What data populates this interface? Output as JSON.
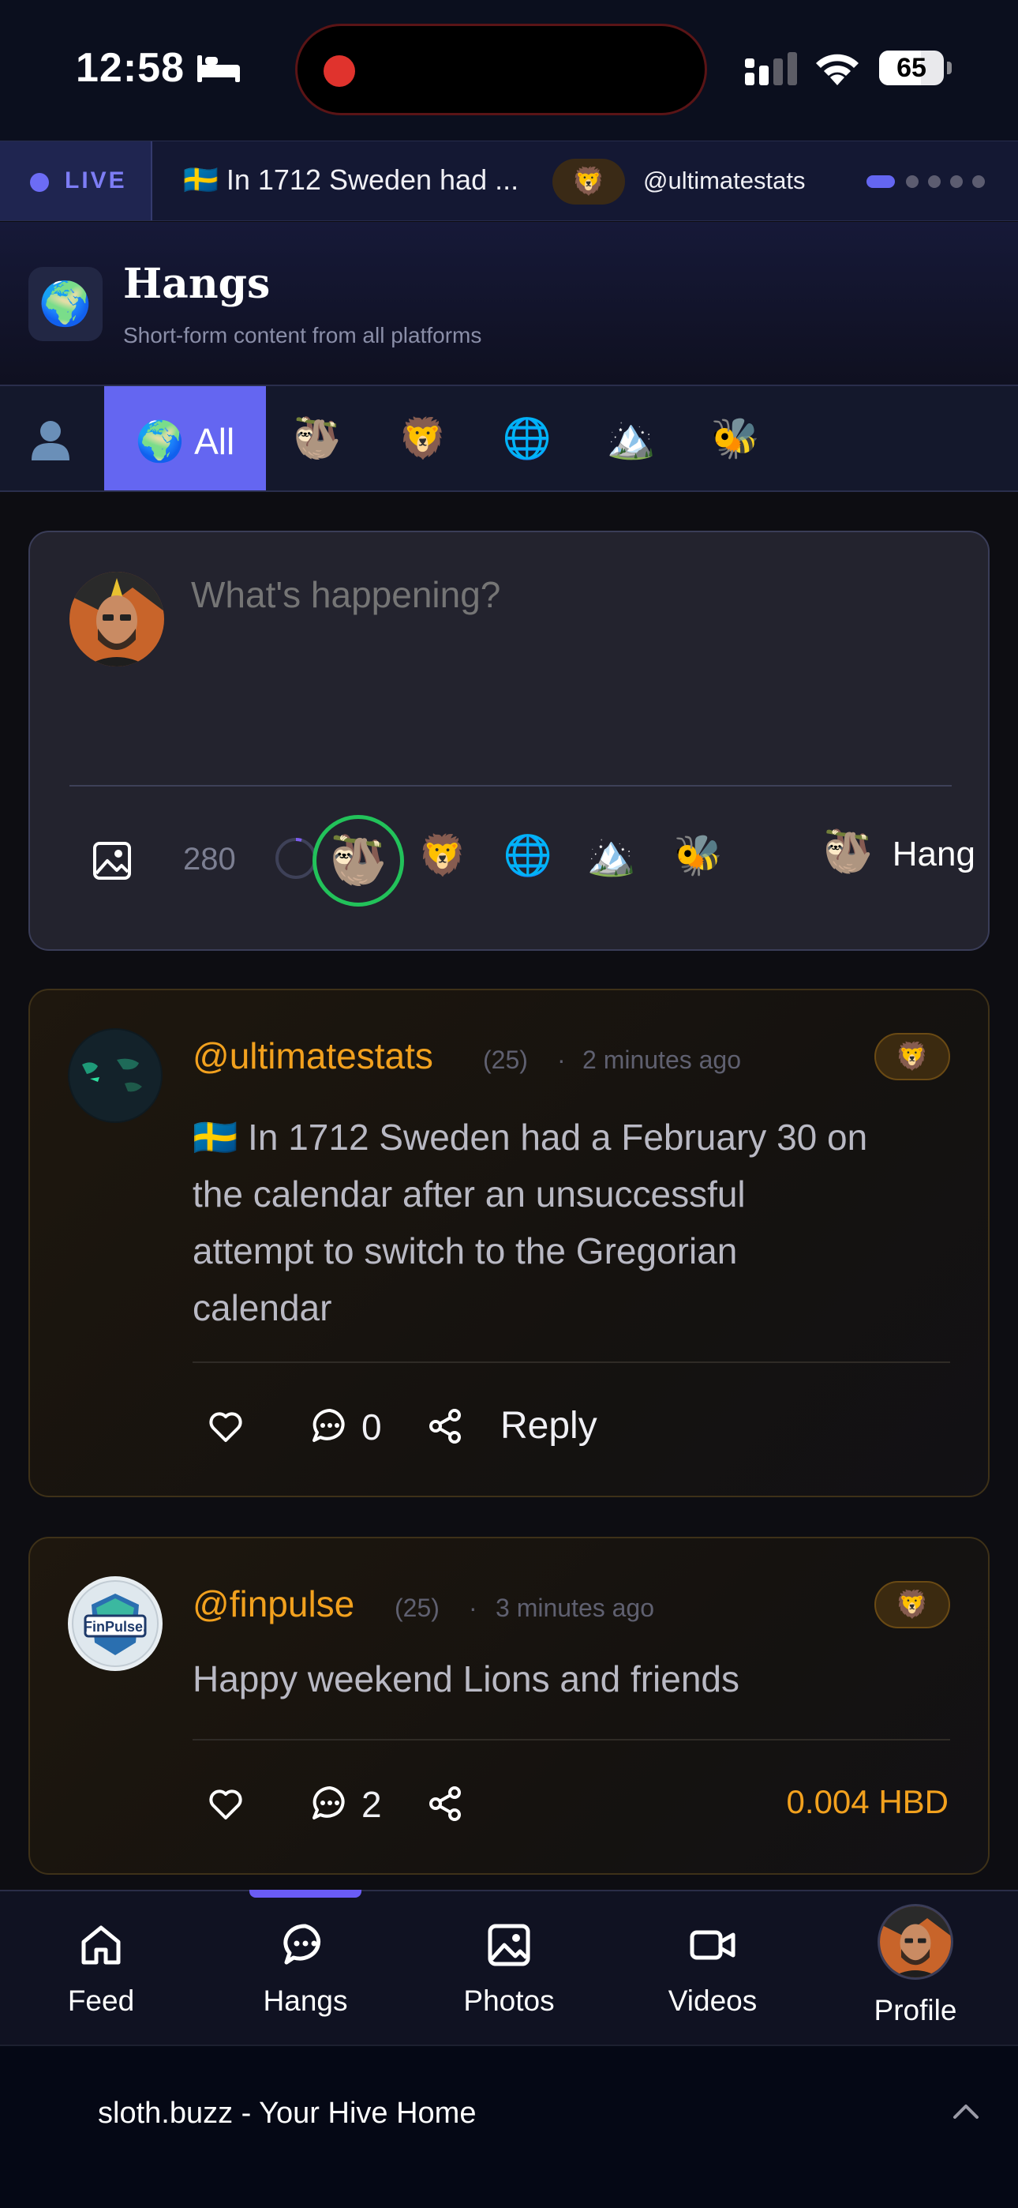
{
  "status_bar": {
    "time": "12:58",
    "battery": "65",
    "battery_level": 0.65
  },
  "ticker": {
    "live_label": "LIVE",
    "headline": "🇸🇪 In 1712 Sweden had ...",
    "badge_emoji": "🦁",
    "author": "@ultimatestats",
    "page_count": 5,
    "active_page": 1
  },
  "header": {
    "icon": "🌍",
    "title": "Hangs",
    "subtitle": "Short-form content from all platforms"
  },
  "categories": {
    "items": [
      {
        "name": "profile",
        "icon": "person-icon"
      },
      {
        "name": "all",
        "emoji": "🌍",
        "label": "All",
        "active": true
      },
      {
        "name": "sloth",
        "emoji": "🦥"
      },
      {
        "name": "lion",
        "emoji": "🦁"
      },
      {
        "name": "world",
        "emoji": "🌐"
      },
      {
        "name": "mountain",
        "emoji": "🏔️"
      },
      {
        "name": "bee",
        "emoji": "🐝"
      }
    ]
  },
  "compose": {
    "placeholder": "What's happening?",
    "char_count": "280",
    "selected_community": "🦥",
    "communities": [
      "🦁",
      "🌐",
      "🏔️",
      "🐝"
    ],
    "target_emoji": "🦥",
    "target_label": "Hang"
  },
  "posts": [
    {
      "author": "@ultimatestats",
      "reputation": "(25)",
      "separator": "·",
      "time": "2 minutes ago",
      "community_badge": "🦁",
      "body_lines": [
        "🇸🇪 In 1712 Sweden had a February 30 on",
        "the calendar after an unsuccessful",
        "attempt to switch to the Gregorian",
        "calendar"
      ],
      "comment_count": "0",
      "reply_label": "Reply"
    },
    {
      "author": "@finpulse",
      "reputation": "(25)",
      "separator": "·",
      "time": "3 minutes ago",
      "community_badge": "🦁",
      "body": "Happy weekend Lions and friends",
      "comment_count": "2",
      "payout": "0.004 HBD"
    }
  ],
  "bottom_nav": {
    "items": [
      {
        "label": "Feed",
        "icon": "home-icon"
      },
      {
        "label": "Hangs",
        "icon": "chat-icon",
        "active": true
      },
      {
        "label": "Photos",
        "icon": "image-icon"
      },
      {
        "label": "Videos",
        "icon": "video-icon"
      },
      {
        "label": "Profile",
        "icon": "avatar"
      }
    ]
  },
  "browser": {
    "title": "sloth.buzz - Your Hive Home"
  },
  "colors": {
    "accent": "#6466f1",
    "gold": "#f2a11e",
    "selected_ring": "#22c25a",
    "live": "#7d7df5"
  }
}
